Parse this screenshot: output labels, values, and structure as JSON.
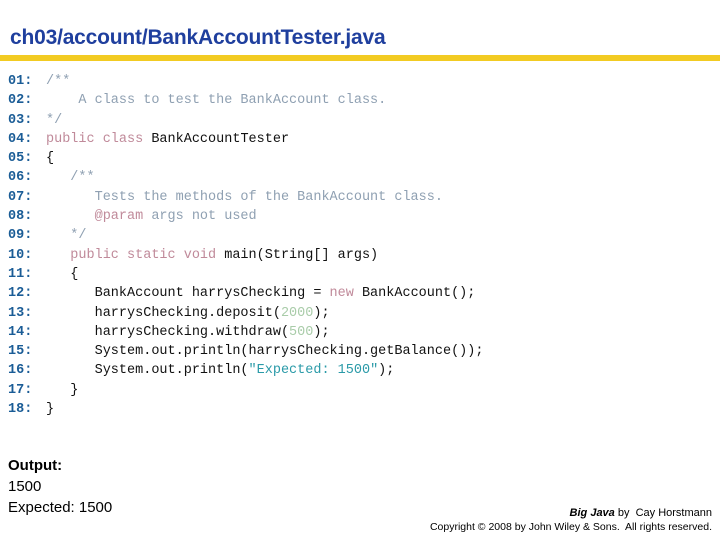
{
  "header": {
    "title": "ch03/account/BankAccountTester.java",
    "rule_color": "#f2cb22",
    "title_color": "#1f3f9e"
  },
  "code": {
    "language": "java",
    "line_number_color": "#1a5c96",
    "token_colors": {
      "comment": "#8fa0b2",
      "javadoc_tag": "#c08a9a",
      "keyword": "#c08a9a",
      "number": "#a9cca9",
      "string": "#2a9aa8",
      "plain": "#111111"
    },
    "lines": [
      {
        "no": "01:",
        "segments": [
          {
            "t": "/**",
            "c": "com"
          }
        ]
      },
      {
        "no": "02:",
        "segments": [
          {
            "t": "    A class to test the BankAccount class.",
            "c": "com"
          }
        ]
      },
      {
        "no": "03:",
        "segments": [
          {
            "t": "*/",
            "c": "com"
          }
        ]
      },
      {
        "no": "04:",
        "segments": [
          {
            "t": "public class ",
            "c": "kw"
          },
          {
            "t": "BankAccountTester",
            "c": "plain"
          }
        ]
      },
      {
        "no": "05:",
        "segments": [
          {
            "t": "{",
            "c": "plain"
          }
        ]
      },
      {
        "no": "06:",
        "segments": [
          {
            "t": "   /**",
            "c": "com"
          }
        ]
      },
      {
        "no": "07:",
        "segments": [
          {
            "t": "      Tests the methods of the BankAccount class.",
            "c": "com"
          }
        ]
      },
      {
        "no": "08:",
        "segments": [
          {
            "t": "      @param",
            "c": "tag"
          },
          {
            "t": " args not used",
            "c": "com"
          }
        ]
      },
      {
        "no": "09:",
        "segments": [
          {
            "t": "   */",
            "c": "com"
          }
        ]
      },
      {
        "no": "10:",
        "segments": [
          {
            "t": "   public static void ",
            "c": "kw"
          },
          {
            "t": "main(String[] args)",
            "c": "plain"
          }
        ]
      },
      {
        "no": "11:",
        "segments": [
          {
            "t": "   {",
            "c": "plain"
          }
        ]
      },
      {
        "no": "12:",
        "segments": [
          {
            "t": "      BankAccount harrysChecking = ",
            "c": "plain"
          },
          {
            "t": "new",
            "c": "kw"
          },
          {
            "t": " BankAccount();",
            "c": "plain"
          }
        ]
      },
      {
        "no": "13:",
        "segments": [
          {
            "t": "      harrysChecking.deposit(",
            "c": "plain"
          },
          {
            "t": "2000",
            "c": "num"
          },
          {
            "t": ");",
            "c": "plain"
          }
        ]
      },
      {
        "no": "14:",
        "segments": [
          {
            "t": "      harrysChecking.withdraw(",
            "c": "plain"
          },
          {
            "t": "500",
            "c": "num"
          },
          {
            "t": ");",
            "c": "plain"
          }
        ]
      },
      {
        "no": "15:",
        "segments": [
          {
            "t": "      System.out.println(harrysChecking.getBalance());",
            "c": "plain"
          }
        ]
      },
      {
        "no": "16:",
        "segments": [
          {
            "t": "      System.out.println(",
            "c": "plain"
          },
          {
            "t": "\"Expected: 1500\"",
            "c": "str"
          },
          {
            "t": ");",
            "c": "plain"
          }
        ]
      },
      {
        "no": "17:",
        "segments": [
          {
            "t": "   }",
            "c": "plain"
          }
        ]
      },
      {
        "no": "18:",
        "segments": [
          {
            "t": "}",
            "c": "plain"
          }
        ]
      }
    ]
  },
  "output": {
    "heading": "Output:",
    "lines": [
      "1500",
      "Expected: 1500"
    ]
  },
  "footer": {
    "book_title": "Big Java",
    "book_byline": " by  Cay Horstmann",
    "copyright": "Copyright © 2008 by John Wiley & Sons.  All rights reserved."
  }
}
